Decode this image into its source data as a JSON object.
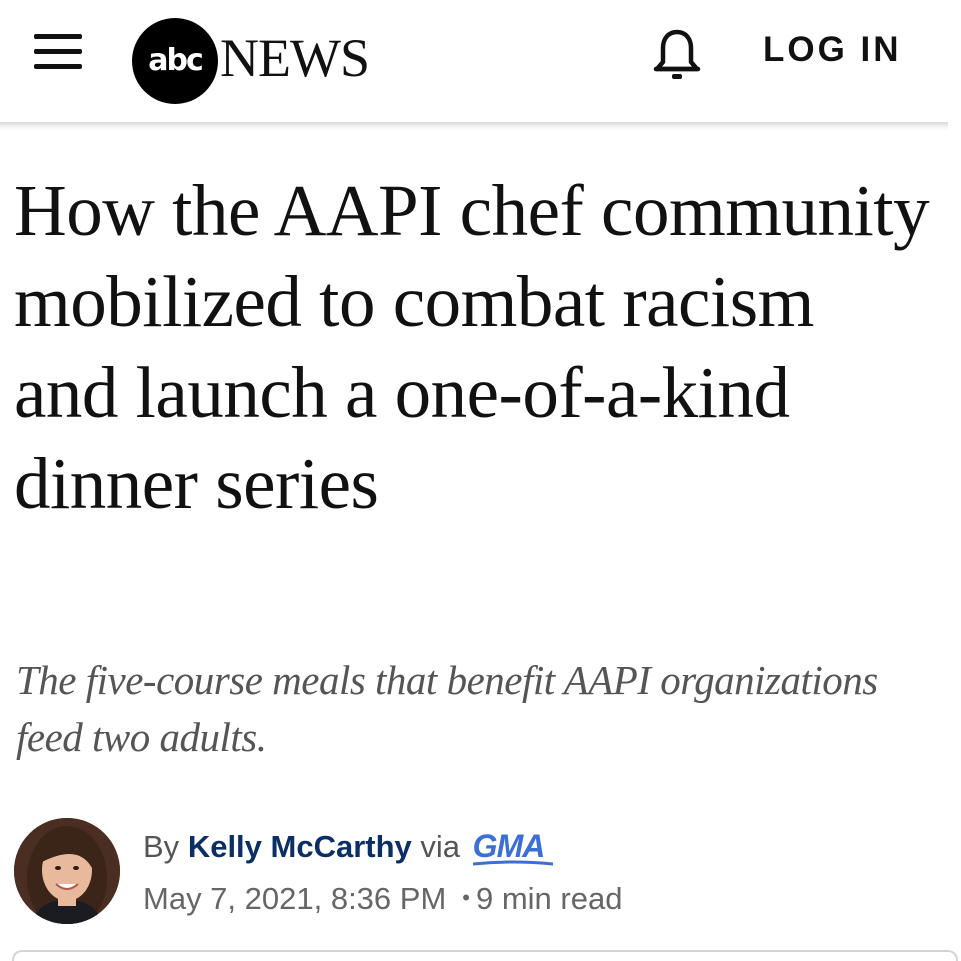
{
  "header": {
    "menu_icon": "hamburger-menu-icon",
    "logo_circle_text": "abc",
    "logo_word": "NEWS",
    "bell_icon": "bell-icon",
    "login_label": "LOG IN"
  },
  "article": {
    "headline": "How the AAPI chef community mobilized to combat racism and launch a one-of-a-kind dinner series",
    "dek": "The five-course meals that benefit AAPI organizations feed two adults.",
    "byline": {
      "by": "By",
      "author": "Kelly McCarthy",
      "via": "via",
      "source": "GMA",
      "date": "May 7, 2021, 8:36 PM",
      "separator": "•",
      "read_time": "9 min read"
    }
  },
  "colors": {
    "author": "#0a2f66",
    "source": "#3b6fd6",
    "dek": "#555555"
  }
}
